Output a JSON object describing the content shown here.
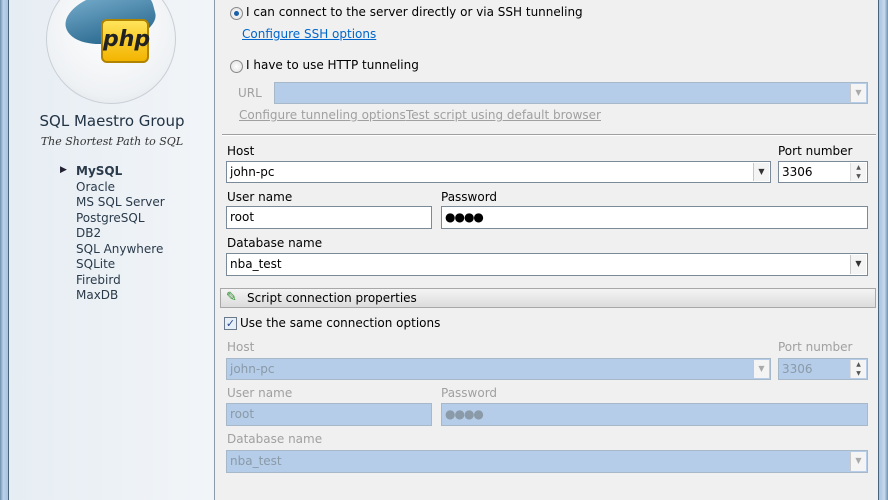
{
  "sidebar": {
    "brand": "SQL Maestro Group",
    "tagline": "The Shortest Path to SQL",
    "logo_text": "php",
    "databases": [
      "MySQL",
      "Oracle",
      "MS SQL Server",
      "PostgreSQL",
      "DB2",
      "SQL Anywhere",
      "SQLite",
      "Firebird",
      "MaxDB"
    ],
    "selected": "MySQL"
  },
  "connection": {
    "direct_label": "I can connect to the server directly or via SSH tunneling",
    "ssh_link": "Configure SSH options",
    "http_label": "I have to use HTTP tunneling",
    "url_label": "URL",
    "url_value": "",
    "tunnel_link": "Configure tunneling options",
    "test_link": "Test script using default browser"
  },
  "main": {
    "host_label": "Host",
    "host": "john-pc",
    "port_label": "Port number",
    "port": "3306",
    "user_label": "User name",
    "user": "root",
    "password_label": "Password",
    "password": "●●●●",
    "db_label": "Database name",
    "db": "nba_test"
  },
  "script": {
    "button_label": "Script connection properties",
    "same_label": "Use the same connection options",
    "same_checked": true,
    "host_label": "Host",
    "host": "john-pc",
    "port_label": "Port number",
    "port": "3306",
    "user_label": "User name",
    "user": "root",
    "password_label": "Password",
    "password": "●●●●",
    "db_label": "Database name",
    "db": "nba_test"
  }
}
